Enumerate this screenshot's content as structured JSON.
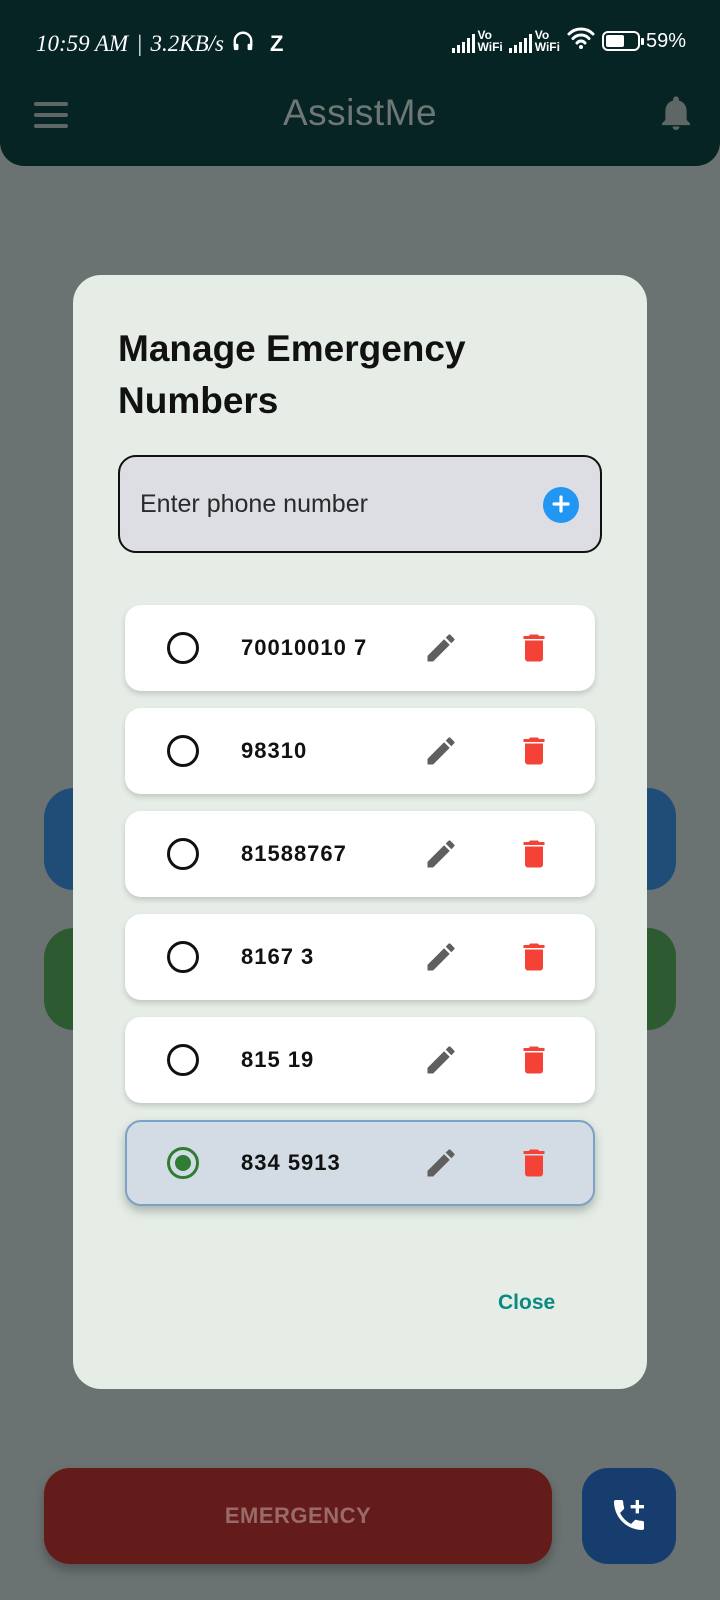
{
  "status_bar": {
    "time": "10:59 AM",
    "network_speed": "3.2KB/s",
    "app_indicator": "Z",
    "vowifi_1": {
      "top": "Vo",
      "bottom": "WiFi"
    },
    "vowifi_2": {
      "top": "Vo",
      "bottom": "WiFi"
    },
    "battery_percent": "59%",
    "battery_level": 0.59
  },
  "app_bar": {
    "title": "AssistMe",
    "menu_icon": "hamburger-menu-icon",
    "notification_icon": "bell-icon"
  },
  "dialog": {
    "title": "Manage Emergency Numbers",
    "input": {
      "placeholder": "Enter phone number",
      "value": ""
    },
    "add_icon": "plus-circle-icon",
    "numbers": [
      {
        "number": "70010010 7",
        "selected": false
      },
      {
        "number": "98310",
        "selected": false
      },
      {
        "number": "81588767",
        "selected": false
      },
      {
        "number": "8167 3",
        "selected": false
      },
      {
        "number": "815 19",
        "selected": false
      },
      {
        "number": "834 5913",
        "selected": true
      }
    ],
    "close_label": "Close"
  },
  "emergency_button_label": "EMERGENCY",
  "add_call_icon": "phone-add-icon",
  "colors": {
    "accent": "#2196f3",
    "selected_radio": "#2e7d32",
    "delete": "#f44336",
    "close_link": "#0a8a80",
    "app_bar": "#062423"
  }
}
